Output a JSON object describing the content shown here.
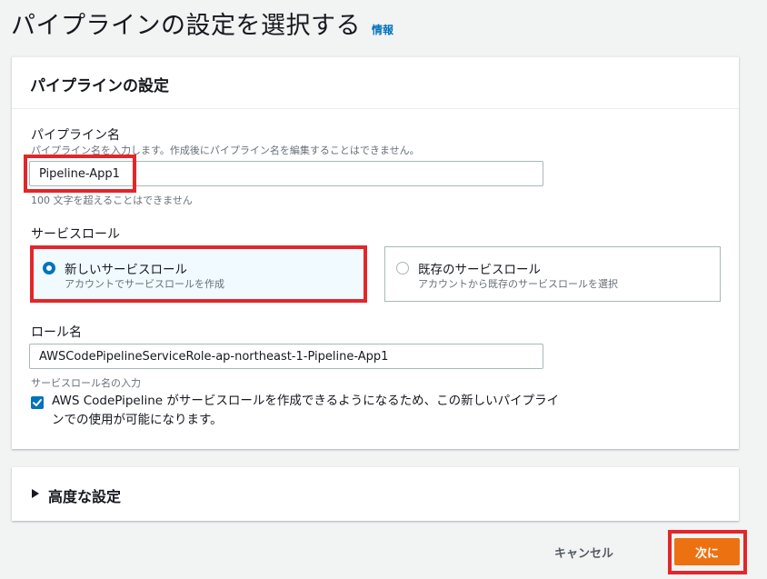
{
  "page": {
    "title": "パイプラインの設定を選択する",
    "info_link": "情報"
  },
  "pipeline_settings": {
    "title": "パイプラインの設定",
    "pipeline_name": {
      "label": "パイプライン名",
      "description": "パイプライン名を入力します。作成後にパイプライン名を編集することはできません。",
      "value": "Pipeline-App1",
      "constraint": "100 文字を超えることはできません"
    },
    "service_role": {
      "label": "サービスロール",
      "options": [
        {
          "title": "新しいサービスロール",
          "description": "アカウントでサービスロールを作成",
          "selected": true
        },
        {
          "title": "既存のサービスロール",
          "description": "アカウントから既存のサービスロールを選択",
          "selected": false
        }
      ]
    },
    "role_name": {
      "label": "ロール名",
      "value": "AWSCodePipelineServiceRole-ap-northeast-1-Pipeline-App1",
      "description": "サービスロール名の入力"
    },
    "allow_checkbox": {
      "checked": true,
      "label": "AWS CodePipeline がサービスロールを作成できるようになるため、この新しいパイプラインでの使用が可能になります。"
    }
  },
  "advanced_settings": {
    "title": "高度な設定"
  },
  "footer": {
    "cancel_label": "キャンセル",
    "next_label": "次に"
  },
  "colors": {
    "accent_orange": "#ec7211",
    "link_blue": "#0073bb",
    "highlight_red": "#e3262a"
  }
}
